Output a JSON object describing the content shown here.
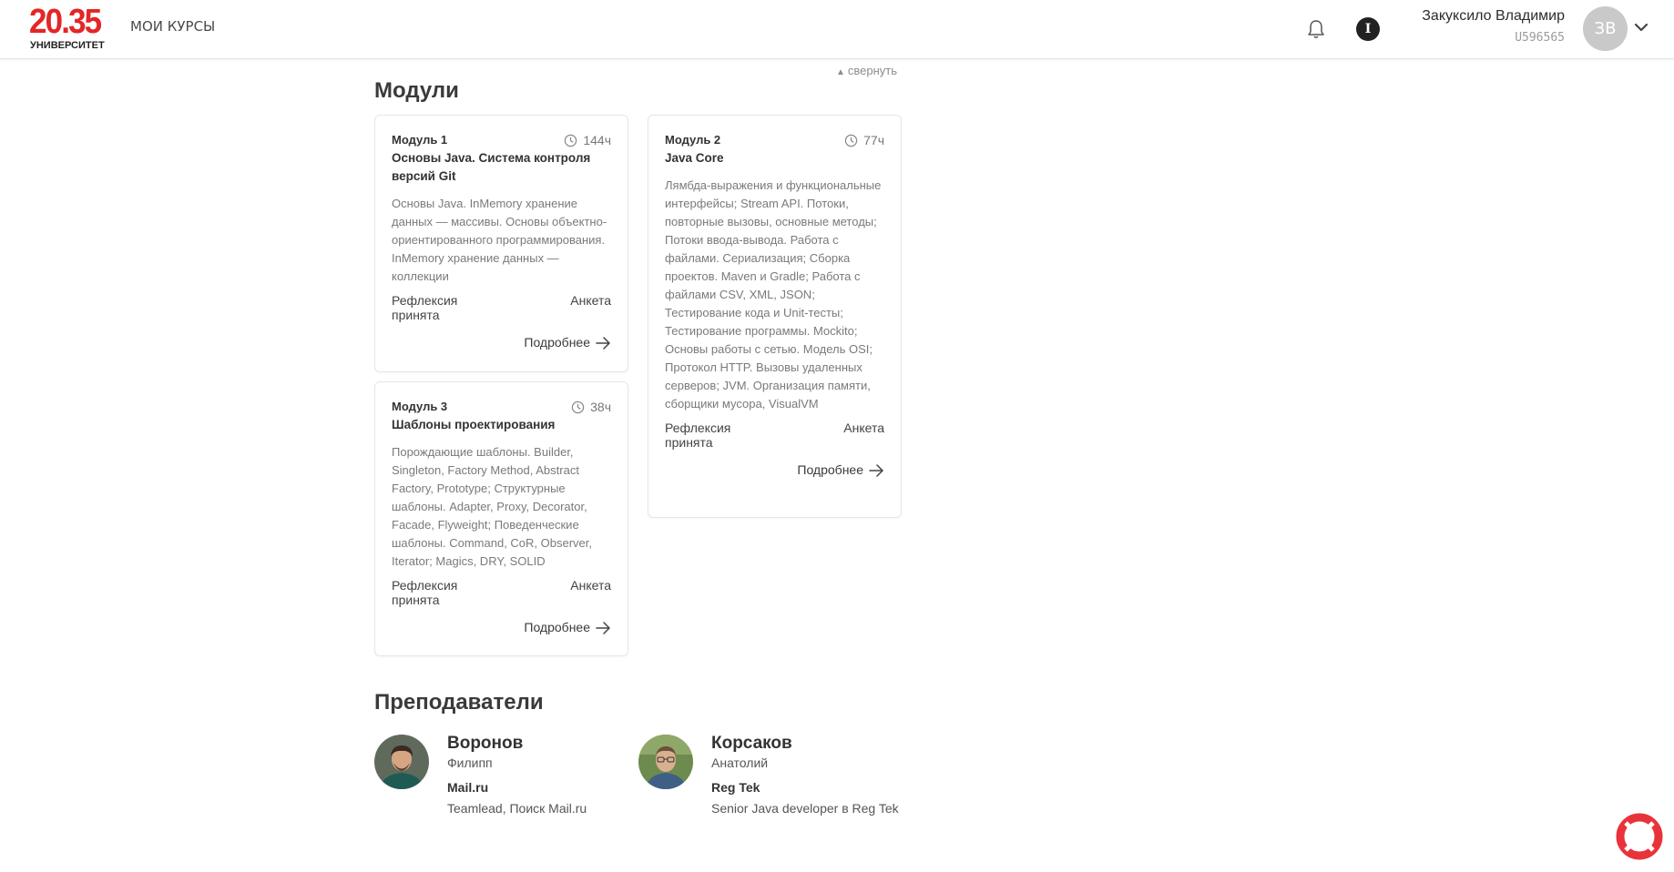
{
  "header": {
    "logo_number": "20.35",
    "logo_caption": "УНИВЕРСИТЕТ",
    "nav_courses": "МОИ КУРСЫ",
    "info_label": "I",
    "user_name": "Закуксило Владимир",
    "user_id": "U596565",
    "avatar_initials": "ЗВ"
  },
  "modules_section": {
    "collapse_label": "свернуть",
    "title": "Модули",
    "modules": [
      {
        "number": "Модуль 1",
        "title": "Основы Java. Система контроля версий Git",
        "hours": "144ч",
        "description": "Основы Java. InMemory хранение данных — массивы. Основы объектно-ориентированного программирования. InMemory хранение данных — коллекции",
        "status": "Рефлексия принята",
        "survey": "Анкета",
        "more": "Подробнее"
      },
      {
        "number": "Модуль 2",
        "title": "Java Core",
        "hours": "77ч",
        "description": "Лямбда-выражения и функциональные интерфейсы; Stream API. Потоки, повторные вызовы, основные методы; Потоки ввода-вывода. Работа с файлами. Сериализация; Сборка проектов. Maven и Gradle; Работа с файлами CSV, XML, JSON; Тестирование кода и Unit-тесты; Тестирование программы. Mockito; Основы работы с сетью. Модель OSI; Протокол HTTP. Вызовы удаленных серверов; JVM. Организация памяти, сборщики мусора, VisualVM",
        "status": "Рефлексия принята",
        "survey": "Анкета",
        "more": "Подробнее"
      },
      {
        "number": "Модуль 3",
        "title": "Шаблоны проектирования",
        "hours": "38ч",
        "description": "Порождающие шаблоны. Builder, Singleton, Factory Method, Abstract Factory, Prototype; Структурные шаблоны. Adapter, Proxy, Decorator, Facade, Flyweight; Поведенческие шаблоны. Command, CoR, Observer, Iterator; Magics, DRY, SOLID",
        "status": "Рефлексия принята",
        "survey": "Анкета",
        "more": "Подробнее"
      }
    ]
  },
  "teachers_section": {
    "title": "Преподаватели",
    "teachers": [
      {
        "last_name": "Воронов",
        "first_name": "Филипп",
        "company": "Mail.ru",
        "position": "Teamlead, Поиск Mail.ru"
      },
      {
        "last_name": "Корсаков",
        "first_name": "Анатолий",
        "company": "Reg Tek",
        "position": "Senior Java developer в Reg Tek"
      }
    ]
  },
  "colors": {
    "brand_red": "#e32626",
    "help_red": "#e8333a",
    "text_dark": "#333333",
    "text_muted": "#7a7a7a"
  },
  "icons": [
    "bell-icon",
    "info-icon",
    "chevron-down-icon",
    "clock-icon",
    "arrow-right-icon",
    "lifebuoy-icon"
  ]
}
